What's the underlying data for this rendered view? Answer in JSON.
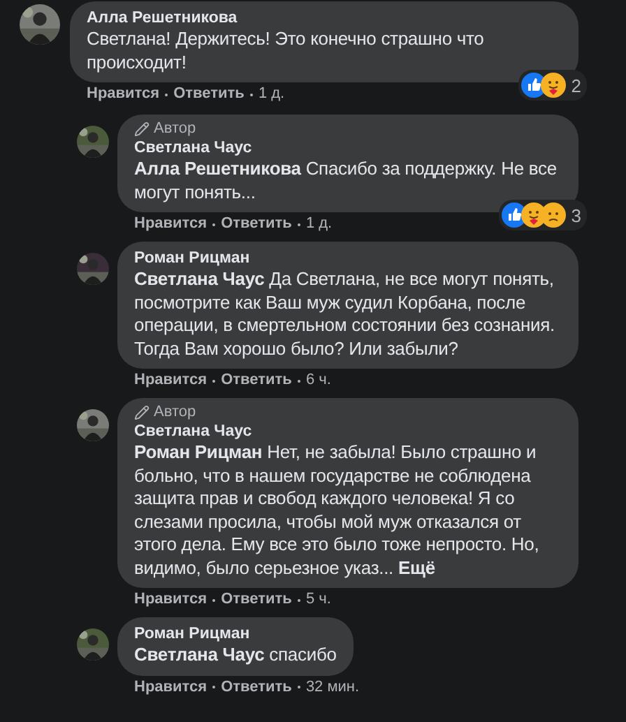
{
  "comments": [
    {
      "author": "Алла Решетникова",
      "text": "Светлана! Держитесь! Это конечно страшно что происходит!",
      "reactions": {
        "icons": [
          {
            "kind": "like"
          },
          {
            "kind": "care"
          }
        ],
        "count": "2"
      },
      "actions": {
        "like": "Нравится",
        "reply": "Ответить",
        "time": "1 д."
      },
      "children": [
        {
          "badge": "Автор",
          "author": "Светлана Чаус",
          "text": "**Алла Решетникова** Спасибо за поддержку. Не все могут понять...",
          "reactions": {
            "icons": [
              {
                "kind": "like"
              },
              {
                "kind": "care"
              },
              {
                "kind": "sad"
              }
            ],
            "count": "3"
          },
          "actions": {
            "like": "Нравится",
            "reply": "Ответить",
            "time": "1 д."
          }
        },
        {
          "author": "Роман Рицман",
          "text": "**Светлана Чаус** Да Светлана, не все могут понять, посмотрите как Ваш муж судил Корбана, после операции, в смертельном состоянии без сознания. Тогда Вам хорошо было? Или забыли?",
          "actions": {
            "like": "Нравится",
            "reply": "Ответить",
            "time": "6 ч."
          }
        },
        {
          "badge": "Автор",
          "author": "Светлана Чаус",
          "text": "**Роман Рицман** Нет, не забыла! Было страшно и больно, что в нашем государстве не соблюдена защита прав и свобод каждого человека! Я со слезами просила, чтобы мой муж отказался от этого дела. Ему все это было тоже непросто. Но, видимо, было серьезное указ...",
          "more": "Ещё",
          "actions": {
            "like": "Нравится",
            "reply": "Ответить",
            "time": "5 ч."
          }
        },
        {
          "author": "Роман Рицман",
          "text": "**Светлана Чаус** спасибо",
          "actions": {
            "like": "Нравится",
            "reply": "Ответить",
            "time": "32 мин."
          }
        }
      ]
    }
  ]
}
